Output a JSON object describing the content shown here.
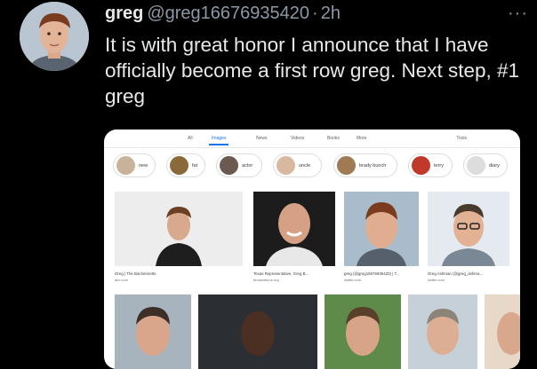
{
  "tweet": {
    "author_name": "greg",
    "handle": "@greg16676935420",
    "separator": "·",
    "time": "2h",
    "more_glyph": "···",
    "text": "It is with great honor I announce that I have officially become a first row greg. Next step, #1 greg"
  },
  "search_screenshot": {
    "tabs": [
      "All",
      "Images",
      "News",
      "Videos",
      "Books",
      "More"
    ],
    "active_tab": "Images",
    "tools_label": "Tools",
    "chips": [
      "new",
      "fat",
      "actor",
      "uncle",
      "brady bunch",
      "terry",
      "diary"
    ],
    "results_row1": [
      {
        "caption": "Greg | The Bachelorette",
        "source": "abc.com"
      },
      {
        "caption": "Texas Representative, Greg B...",
        "source": "texastribune.org"
      },
      {
        "caption": "greg (@greg16676935420) | T...",
        "source": "twitter.com"
      },
      {
        "caption": "Greg Ashman (@greg_ashma...",
        "source": "twitter.com"
      }
    ]
  },
  "colors": {
    "background": "#000000",
    "text": "#e7e9ea",
    "muted": "#8b98a5",
    "google_blue": "#1a73e8"
  }
}
